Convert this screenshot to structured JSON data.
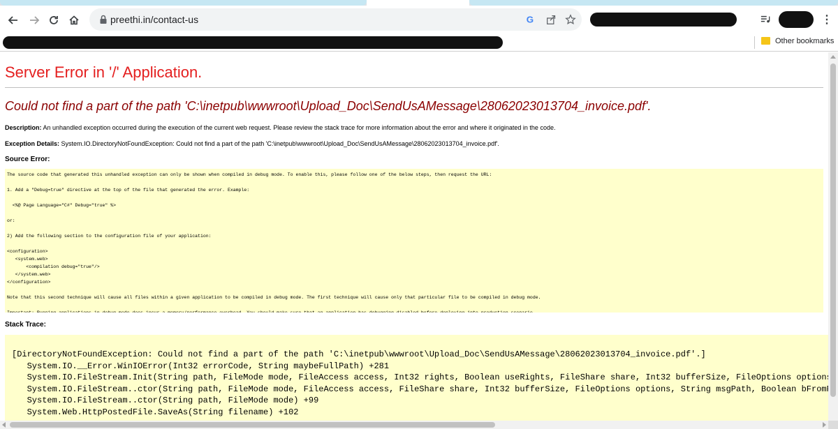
{
  "browser": {
    "url": "preethi.in/contact-us",
    "bookmarks": {
      "other_bookmarks": "Other bookmarks"
    }
  },
  "page": {
    "title": "Server Error in '/' Application.",
    "error_message": "Could not find a part of the path 'C:\\inetpub\\wwwroot\\Upload_Doc\\SendUsAMessage\\28062023013704_invoice.pdf'.",
    "description_label": "Description:",
    "description_text": "An unhandled exception occurred during the execution of the current web request. Please review the stack trace for more information about the error and where it originated in the code.",
    "exception_label": "Exception Details:",
    "exception_text": "System.IO.DirectoryNotFoundException: Could not find a part of the path 'C:\\inetpub\\wwwroot\\Upload_Doc\\SendUsAMessage\\28062023013704_invoice.pdf'.",
    "source_error_heading": "Source Error:",
    "source_error_text": "The source code that generated this unhandled exception can only be shown when compiled in debug mode. To enable this, please follow one of the below steps, then request the URL:\n\n1. Add a \"Debug=true\" directive at the top of the file that generated the error. Example:\n\n  <%@ Page Language=\"C#\" Debug=\"true\" %>\n\nor:\n\n2) Add the following section to the configuration file of your application:\n\n<configuration>\n   <system.web>\n       <compilation debug=\"true\"/>\n   </system.web>\n</configuration>\n\nNote that this second technique will cause all files within a given application to be compiled in debug mode. The first technique will cause only that particular file to be compiled in debug mode.\n\nImportant: Running applications in debug mode does incur a memory/performance overhead. You should make sure that an application has debugging disabled before deploying into production scenario.",
    "stack_trace_heading": "Stack Trace:",
    "stack_trace_text": "[DirectoryNotFoundException: Could not find a part of the path 'C:\\inetpub\\wwwroot\\Upload_Doc\\SendUsAMessage\\28062023013704_invoice.pdf'.]\n   System.IO.__Error.WinIOError(Int32 errorCode, String maybeFullPath) +281\n   System.IO.FileStream.Init(String path, FileMode mode, FileAccess access, Int32 rights, Boolean useRights, FileShare share, Int32 bufferSize, FileOptions options,\n   System.IO.FileStream..ctor(String path, FileMode mode, FileAccess access, FileShare share, Int32 bufferSize, FileOptions options, String msgPath, Boolean bFromPro\n   System.IO.FileStream..ctor(String path, FileMode mode) +99\n   System.Web.HttpPostedFile.SaveAs(String filename) +102"
  },
  "colors": {
    "title": "#e41f1f",
    "error_message": "#8b0000",
    "code_background": "#ffffcc"
  }
}
